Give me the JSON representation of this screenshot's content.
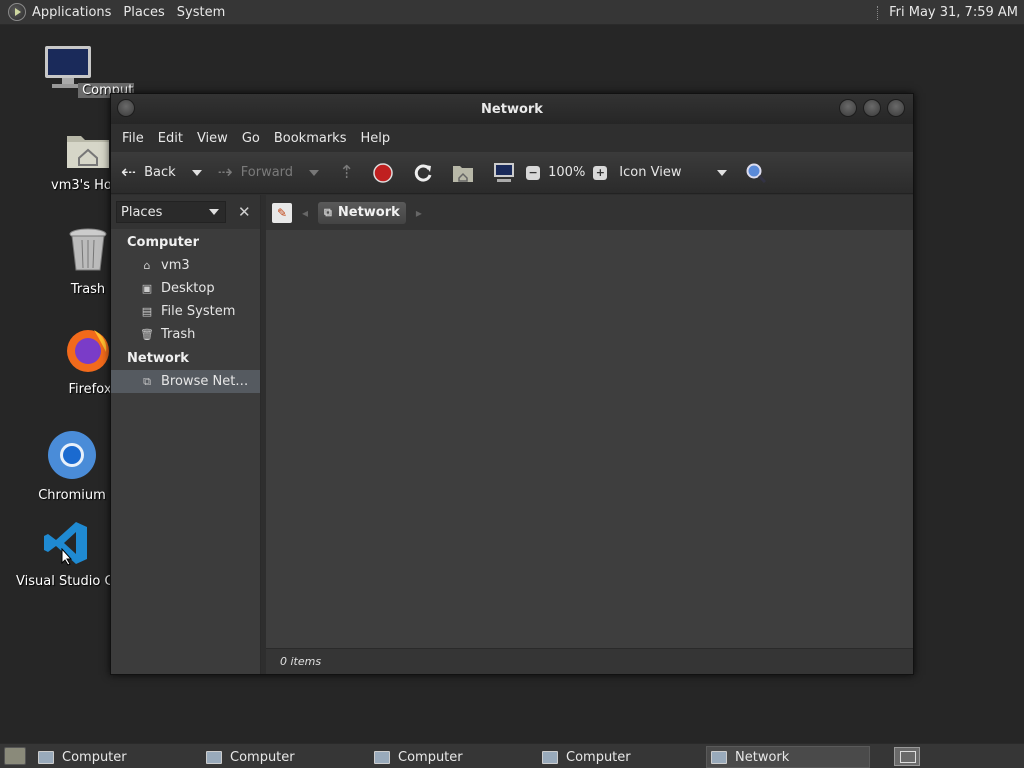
{
  "top_panel": {
    "menus": [
      "Applications",
      "Places",
      "System"
    ],
    "clock": "Fri May 31,  7:59 AM"
  },
  "desktop_icons": [
    {
      "label": "Computer",
      "icon": "computer-icon"
    },
    {
      "label": "vm3's Home",
      "icon": "home-folder-icon"
    },
    {
      "label": "Trash",
      "icon": "trash-icon"
    },
    {
      "label": "Firefox",
      "icon": "firefox-icon"
    },
    {
      "label": "Chromium",
      "icon": "chromium-icon"
    },
    {
      "label": "Visual Studio Code",
      "icon": "vscode-icon"
    }
  ],
  "window": {
    "title": "Network",
    "menu": [
      "File",
      "Edit",
      "View",
      "Go",
      "Bookmarks",
      "Help"
    ],
    "toolbar": {
      "back": "Back",
      "forward": "Forward",
      "zoom": "100%",
      "view_mode": "Icon View"
    },
    "sidebar": {
      "selector": "Places",
      "sections": [
        {
          "title": "Computer",
          "items": [
            "vm3",
            "Desktop",
            "File System",
            "Trash"
          ]
        },
        {
          "title": "Network",
          "items": [
            "Browse Net…"
          ]
        }
      ]
    },
    "location": {
      "crumb": "Network"
    },
    "status": "0 items"
  },
  "taskbar": {
    "tasks": [
      "Computer",
      "Computer",
      "Computer",
      "Computer",
      "Network"
    ]
  },
  "colors": {
    "panel": "#363636",
    "desktop": "#262626",
    "window_bg": "#3e3e3e",
    "stop_red": "#c02020",
    "selected": "#555a60"
  }
}
